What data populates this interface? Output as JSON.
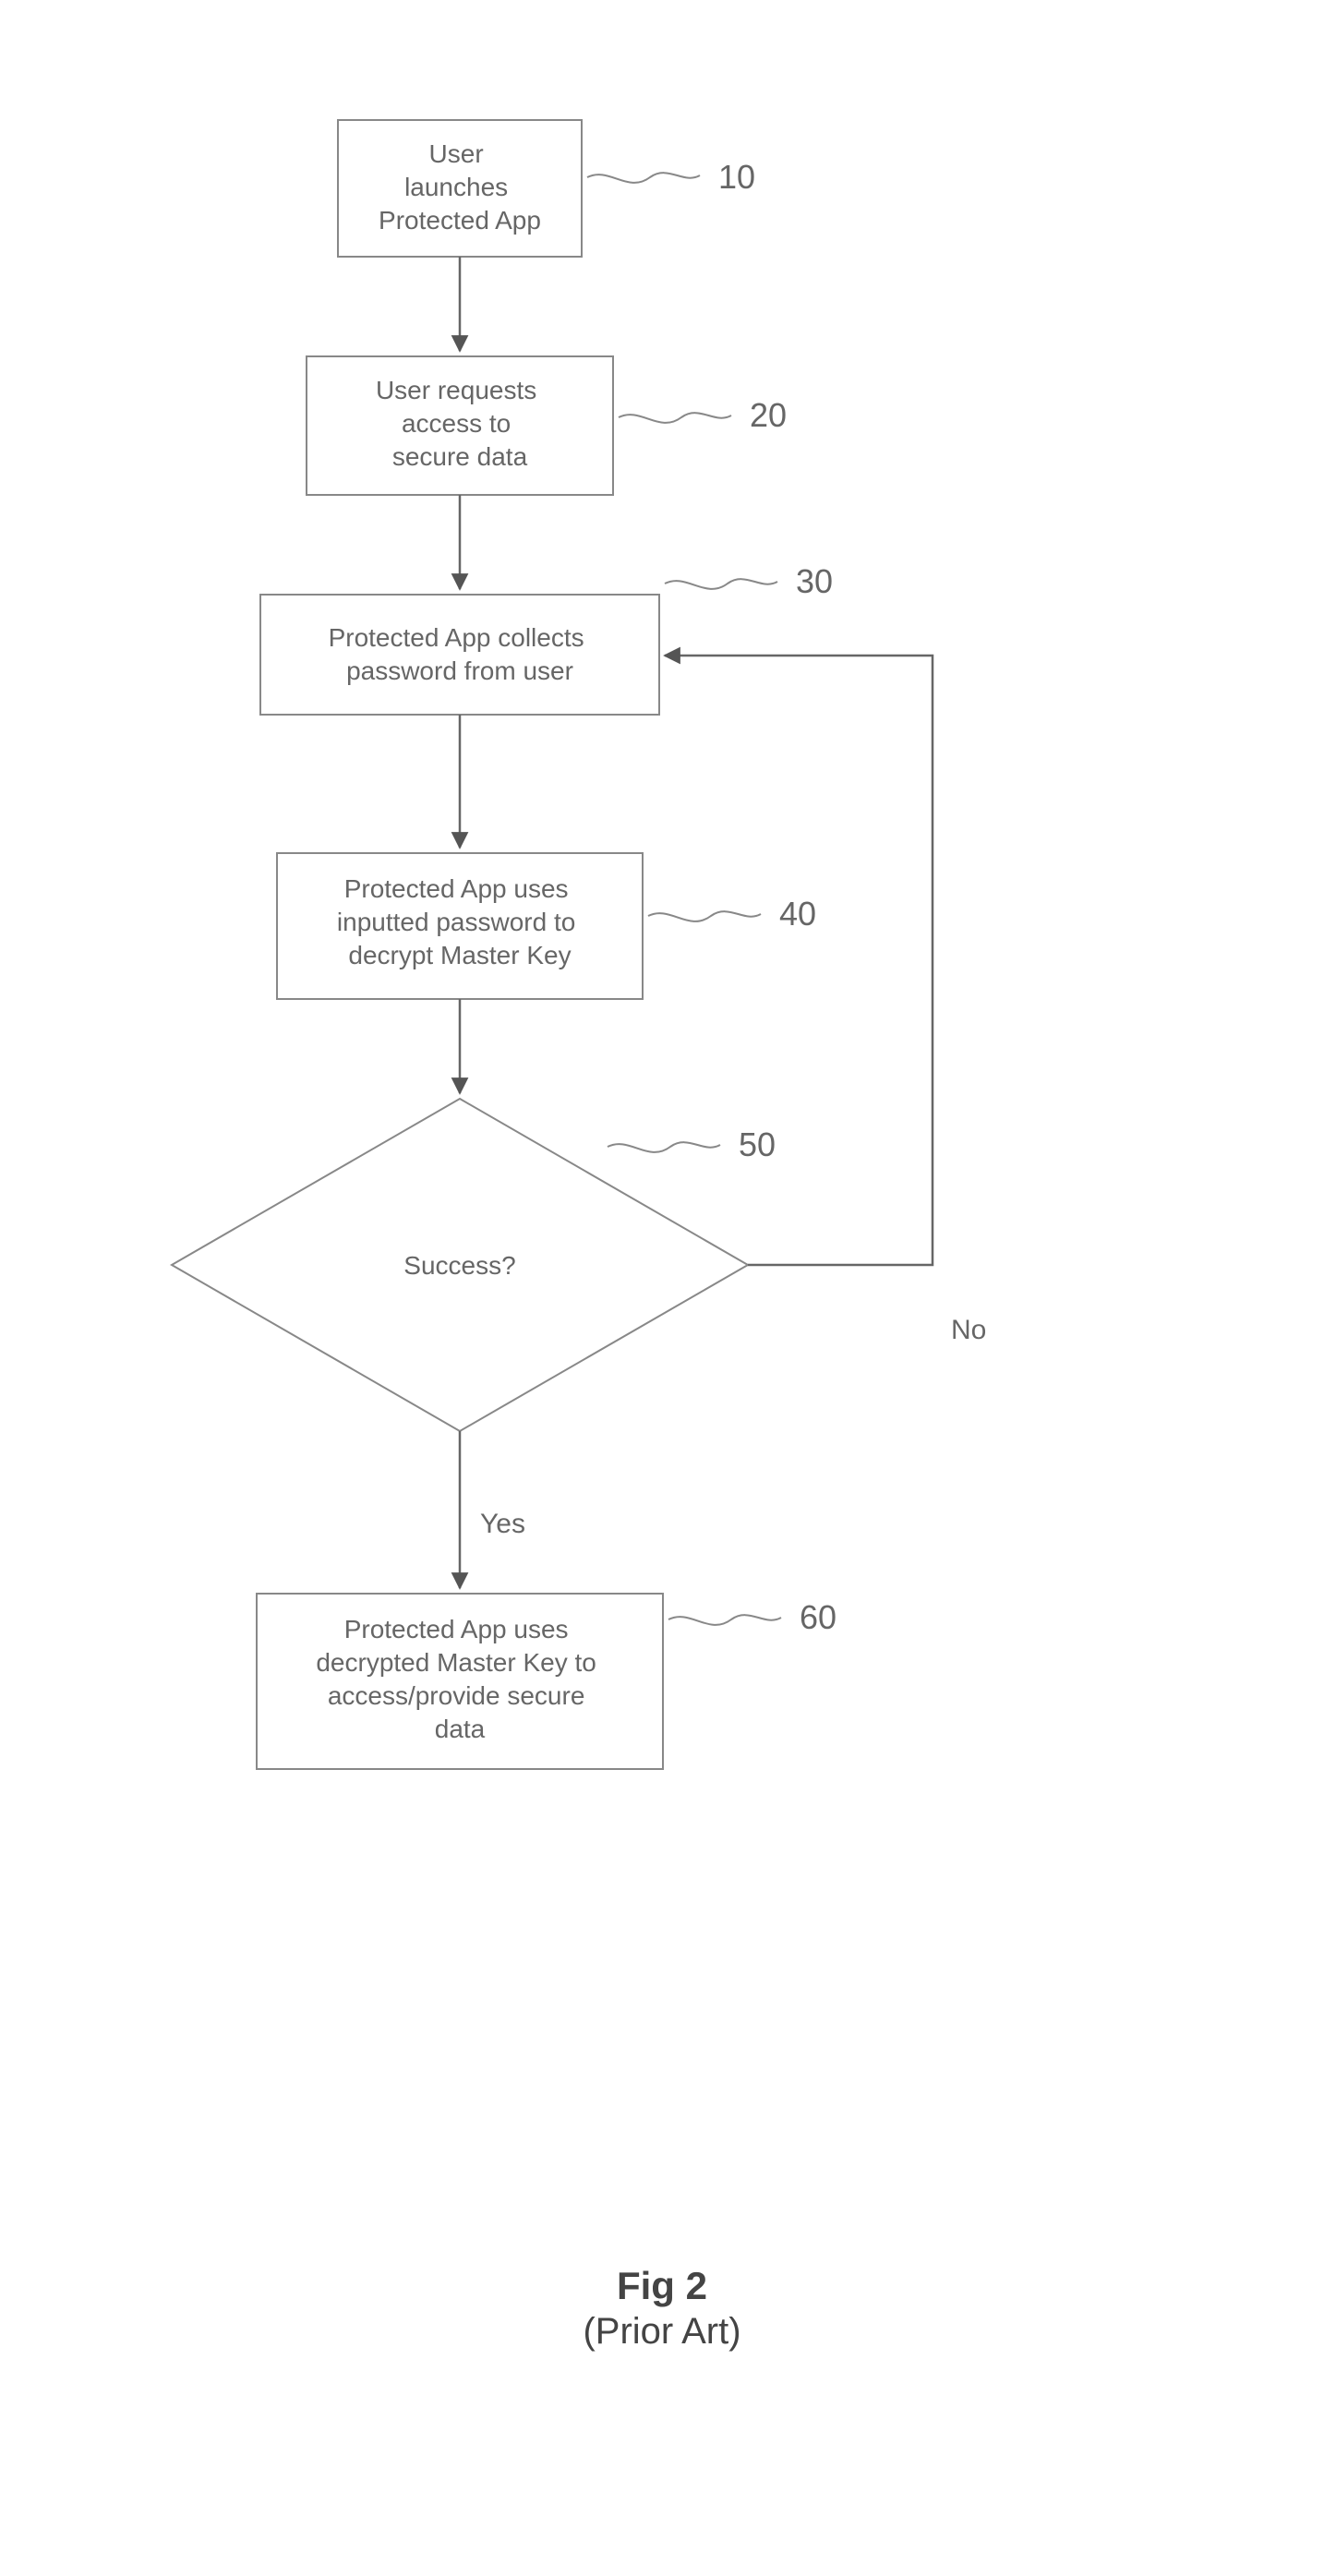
{
  "nodes": {
    "n10": {
      "ref": "10",
      "lines": [
        "User",
        "launches",
        "Protected App"
      ]
    },
    "n20": {
      "ref": "20",
      "lines": [
        "User requests",
        "access to",
        "secure data"
      ]
    },
    "n30": {
      "ref": "30",
      "lines": [
        "Protected App collects",
        "password from user"
      ]
    },
    "n40": {
      "ref": "40",
      "lines": [
        "Protected App uses",
        "inputted password to",
        "decrypt Master Key"
      ]
    },
    "n50": {
      "ref": "50",
      "lines": [
        "Success?"
      ]
    },
    "n60": {
      "ref": "60",
      "lines": [
        "Protected App uses",
        "decrypted Master Key to",
        "access/provide secure",
        "data"
      ]
    }
  },
  "edges": {
    "yes": "Yes",
    "no": "No"
  },
  "caption": {
    "title": "Fig 2",
    "subtitle": "(Prior Art)"
  },
  "chart_data": {
    "type": "flowchart",
    "nodes": [
      {
        "id": "10",
        "shape": "process",
        "text": "User launches Protected App"
      },
      {
        "id": "20",
        "shape": "process",
        "text": "User requests access to secure data"
      },
      {
        "id": "30",
        "shape": "process",
        "text": "Protected App collects password from user"
      },
      {
        "id": "40",
        "shape": "process",
        "text": "Protected App uses inputted password to decrypt Master Key"
      },
      {
        "id": "50",
        "shape": "decision",
        "text": "Success?"
      },
      {
        "id": "60",
        "shape": "process",
        "text": "Protected App uses decrypted Master Key to access/provide secure data"
      }
    ],
    "edges": [
      {
        "from": "10",
        "to": "20"
      },
      {
        "from": "20",
        "to": "30"
      },
      {
        "from": "30",
        "to": "40"
      },
      {
        "from": "40",
        "to": "50"
      },
      {
        "from": "50",
        "to": "60",
        "label": "Yes"
      },
      {
        "from": "50",
        "to": "30",
        "label": "No"
      }
    ],
    "title": "Fig 2 (Prior Art)"
  }
}
